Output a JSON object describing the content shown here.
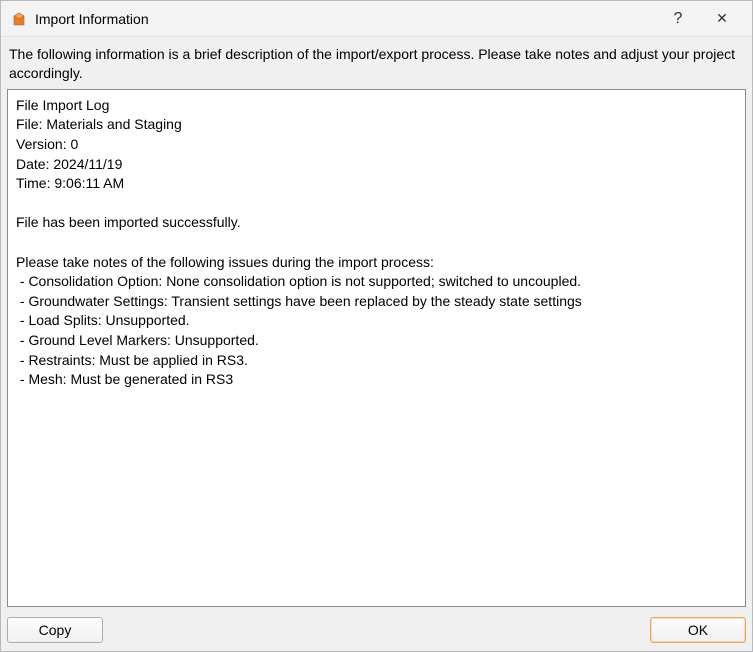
{
  "titlebar": {
    "title": "Import Information",
    "help_label": "?",
    "close_label": "✕"
  },
  "description": "The following information is a brief description of the import/export process. Please take notes and adjust your project accordingly.",
  "log": {
    "heading": "File Import Log",
    "file_label": "File: Materials and Staging",
    "version_label": "Version: 0",
    "date_label": "Date: 2024/11/19",
    "time_label": "Time: 9:06:11 AM",
    "success_msg": "File has been imported successfully.",
    "issues_heading": "Please take notes of the following issues during the import process:",
    "issues": [
      " - Consolidation Option: None consolidation option is not supported; switched to uncoupled.",
      " - Groundwater Settings: Transient settings have been replaced by the steady state settings",
      " - Load Splits: Unsupported.",
      " - Ground Level Markers: Unsupported.",
      " - Restraints: Must be applied in RS3.",
      " - Mesh: Must be generated in RS3"
    ]
  },
  "buttons": {
    "copy_label": "Copy",
    "ok_label": "OK"
  },
  "colors": {
    "window_bg": "#f0f0f0",
    "border": "#8c8c8c",
    "ok_accent": "#e7a95a"
  }
}
